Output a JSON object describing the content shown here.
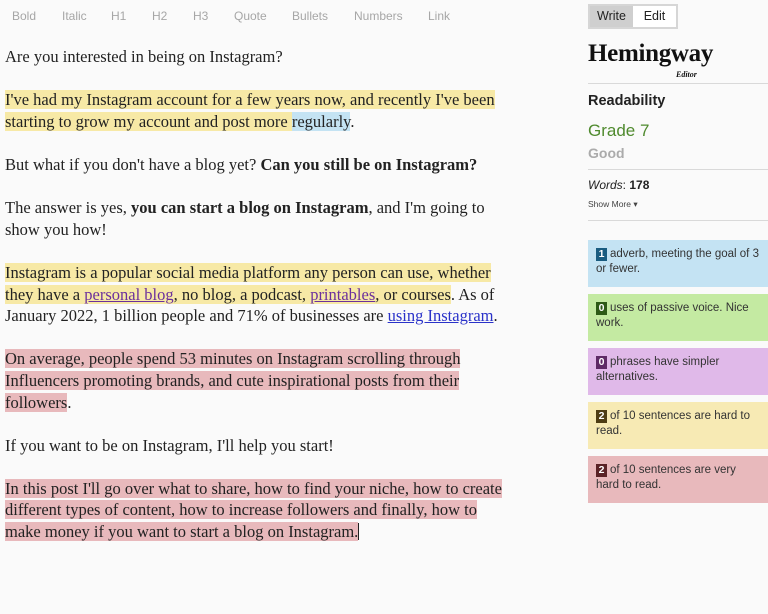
{
  "toolbar": {
    "items": [
      "Bold",
      "Italic",
      "H1",
      "H2",
      "H3",
      "Quote",
      "Bullets",
      "Numbers",
      "Link"
    ]
  },
  "editor": {
    "p1": "Are you interested in being on Instagram?",
    "p2": {
      "hard_a": "I've had my Instagram account for a few years now, and recently I've been starting to grow my account and post more ",
      "adverb": "regularly",
      "end": "."
    },
    "p3": {
      "plain": "But what if you don't have a blog yet? ",
      "bold": "Can you still be on Instagram?"
    },
    "p4": {
      "plain_a": "The answer is yes, ",
      "bold": "you can start a blog on Instagram",
      "plain_b": ", and I'm going to show you how!"
    },
    "p5": {
      "hard_a": "Instagram is a popular social media platform any person can use, whether they have a ",
      "link1": "personal blog",
      "hard_b": ", no blog, a podcast, ",
      "link2": "printables",
      "hard_c": ", or courses",
      "plain_a": ". As of January 2022, 1 billion people and 71% of businesses are ",
      "link3": "using Instagram",
      "plain_b": "."
    },
    "p6": {
      "very_hard": "On average, people spend 53 minutes on Instagram scrolling through Influencers promoting brands, and cute inspirational posts from their followers",
      "end": "."
    },
    "p7": "If you want to be on Instagram, I'll help you start!",
    "p8": {
      "very_hard": "In this post I'll go over what to share, how to find your niche, how to create different types of content, how to increase followers and finally, how to make money if you want to start a blog on Instagram."
    }
  },
  "sidebar": {
    "mode": {
      "write": "Write",
      "edit": "Edit",
      "active": "Write"
    },
    "logo": "Hemingway",
    "logo_sub": "Editor",
    "readability_label": "Readability",
    "grade": "Grade 7",
    "grade_desc": "Good",
    "words_label": "Words",
    "words_count": "178",
    "show_more": "Show More ▾",
    "cards": [
      {
        "count": "1",
        "text": "adverb, meeting the goal of 3 or fewer.",
        "color": "#c4e3f3"
      },
      {
        "count": "0",
        "text": "uses of passive voice. Nice work.",
        "color": "#c4eaa2"
      },
      {
        "count": "0",
        "text": "phrases have simpler alternatives.",
        "color": "#e0b9e9"
      },
      {
        "count": "2",
        "text": "of 10 sentences are hard to read.",
        "color": "#f7eab4"
      },
      {
        "count": "2",
        "text": "of 10 sentences are very hard to read.",
        "color": "#e8b9bc"
      }
    ]
  }
}
